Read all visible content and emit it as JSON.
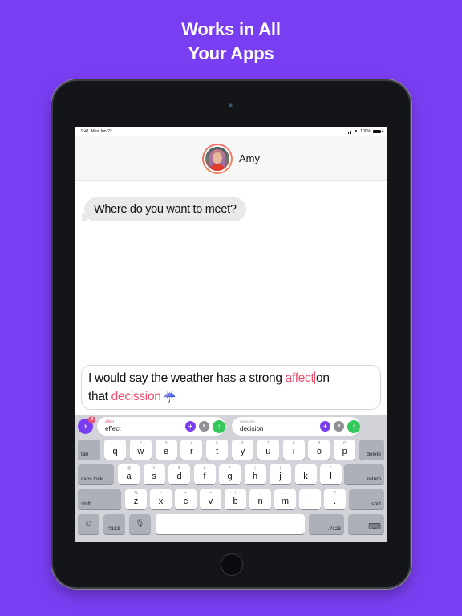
{
  "headline": {
    "line1": "Works in All",
    "line2": "Your Apps"
  },
  "colors": {
    "background": "#7a3ef2",
    "accent": "#7a3ef2",
    "error": "#f0506e",
    "accept": "#34c759",
    "dismiss": "#8e8e93"
  },
  "status_bar": {
    "time": "9:41",
    "date": "Mon Jun 22",
    "battery": "100%"
  },
  "conversation": {
    "contact_name": "Amy",
    "messages": [
      {
        "sender": "Amy",
        "text": "Where do you want to meet?"
      }
    ]
  },
  "compose": {
    "segments": [
      {
        "text": "I would say the weather has a strong ",
        "error": false
      },
      {
        "text": "affect",
        "error": true
      },
      {
        "text": "on",
        "error": false,
        "after_caret": true
      },
      {
        "text": "that ",
        "error": false
      },
      {
        "text": "decission",
        "error": true
      },
      {
        "text": " ☔",
        "error": false
      }
    ]
  },
  "suggestions": {
    "count_badge": "2",
    "expand_icon": "chevron-right-icon",
    "items": [
      {
        "original": "affect",
        "correction": "effect"
      },
      {
        "original": "decission",
        "correction": "decision"
      }
    ],
    "add_symbol": "+",
    "dismiss_symbol": "×",
    "accept_symbol": "↑"
  },
  "keyboard": {
    "row1": [
      {
        "main": "q",
        "sub": "1"
      },
      {
        "main": "w",
        "sub": "2"
      },
      {
        "main": "e",
        "sub": "3"
      },
      {
        "main": "r",
        "sub": "4"
      },
      {
        "main": "t",
        "sub": "5"
      },
      {
        "main": "y",
        "sub": "6"
      },
      {
        "main": "u",
        "sub": "7"
      },
      {
        "main": "i",
        "sub": "8"
      },
      {
        "main": "o",
        "sub": "9"
      },
      {
        "main": "p",
        "sub": "0"
      }
    ],
    "row2": [
      {
        "main": "a",
        "sub": "@"
      },
      {
        "main": "s",
        "sub": "#"
      },
      {
        "main": "d",
        "sub": "$"
      },
      {
        "main": "f",
        "sub": "&"
      },
      {
        "main": "g",
        "sub": "*"
      },
      {
        "main": "h",
        "sub": "("
      },
      {
        "main": "j",
        "sub": ")"
      },
      {
        "main": "k",
        "sub": "'"
      },
      {
        "main": "l",
        "sub": "\""
      }
    ],
    "row3": [
      {
        "main": "z",
        "sub": "%"
      },
      {
        "main": "x",
        "sub": "-"
      },
      {
        "main": "c",
        "sub": "+"
      },
      {
        "main": "v",
        "sub": "="
      },
      {
        "main": "b",
        "sub": "/"
      },
      {
        "main": "n",
        "sub": ";"
      },
      {
        "main": "m",
        "sub": ":"
      },
      {
        "main": ",",
        "sub": "!"
      },
      {
        "main": ".",
        "sub": "?"
      }
    ],
    "tab": "tab",
    "delete": "delete",
    "caps_lock": "caps lock",
    "return": "return",
    "shift": "shift",
    "numbers": ".?123",
    "emoji": "☺",
    "mic": "🎙",
    "hide": "⌨"
  }
}
